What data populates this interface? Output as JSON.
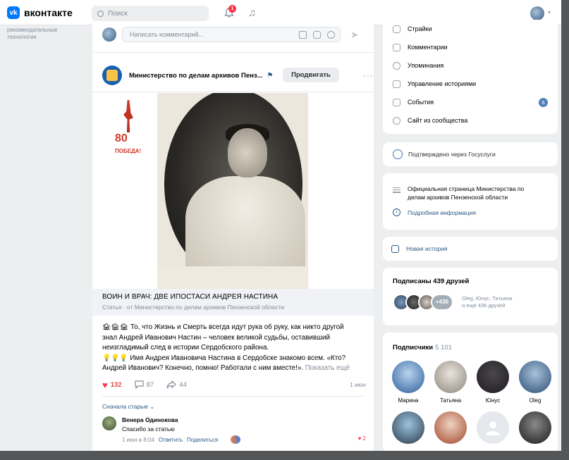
{
  "topbar": {
    "logo_mark": "vk",
    "logo_text": "вконтакте",
    "search_placeholder": "Поиск",
    "notifications_count": "1",
    "music_icon": "♫"
  },
  "leftnav": {
    "text": "рекомендательные технологии"
  },
  "post": {
    "comment_placeholder": "Написать комментарий...",
    "send_icon": "➤",
    "group_name": "Министерство по делам архивов Пенз...",
    "flag_icon": "⚑",
    "promote_label": "Продвигать",
    "dots_icon": "···",
    "poster_num": "80",
    "poster_text": "ПОБЕДА!",
    "article_title": "ВОИН И ВРАЧ: ДВЕ ИПОСТАСИ АНДРЕЯ НАСТИНА",
    "article_sub": "Статья · от Министерство по делам архивов Пензенской области",
    "text_line1": "🏚🏚🏚 То, что Жизнь и Смерть всегда идут рука об руку, как никто другой",
    "text_line2": "знал Андрей Иванович Настин – человек великой судьбы, оставивший",
    "text_line3": "неизгладимый след в истории Сердобского района.",
    "text_line4": "💡💡💡 Имя Андрея Ивановича Настина в Сердобске знакомо всем. «Кто?",
    "text_line5": "Андрей Иванович? Конечно, помню! Работали с ним вместе!».",
    "show_more": "Показать ещё",
    "likes": "132",
    "comments": "87",
    "shares": "44",
    "date": "1 июн",
    "sort_label": "Сначала старые ⌄",
    "comment": {
      "author": "Венера Одинокова",
      "text": "Спасибо за статью",
      "time": "1 июн в 8:04",
      "reply": "Ответить",
      "share": "Поделиться",
      "likes": "♥ 2"
    }
  },
  "right": {
    "menu": [
      {
        "label": "Страйки"
      },
      {
        "label": "Комментарии"
      },
      {
        "label": "Упоминания"
      },
      {
        "label": "Управление историями"
      },
      {
        "label": "События",
        "badge": "6"
      },
      {
        "label": "Сайт из сообщества"
      }
    ],
    "gosuslugi": "Подтверждено через Госуслуги",
    "official_line1": "Официальная страница Министерства по",
    "official_line2": "делам архивов Пензенской области",
    "details_link": "Подробная информация",
    "new_story": "Новая история",
    "friends_title": "Подписаны 439 друзей",
    "friends_more": "+436",
    "friends_names_line1": "Oleg, Юнус, Татьяна",
    "friends_names_line2": "и ещё 436 друзей",
    "subs_title": "Подписчики",
    "subs_count": "5 101",
    "subscribers": [
      {
        "name": "Марина"
      },
      {
        "name": "Татьяна"
      },
      {
        "name": "Юнус"
      },
      {
        "name": "Oleg"
      }
    ]
  }
}
